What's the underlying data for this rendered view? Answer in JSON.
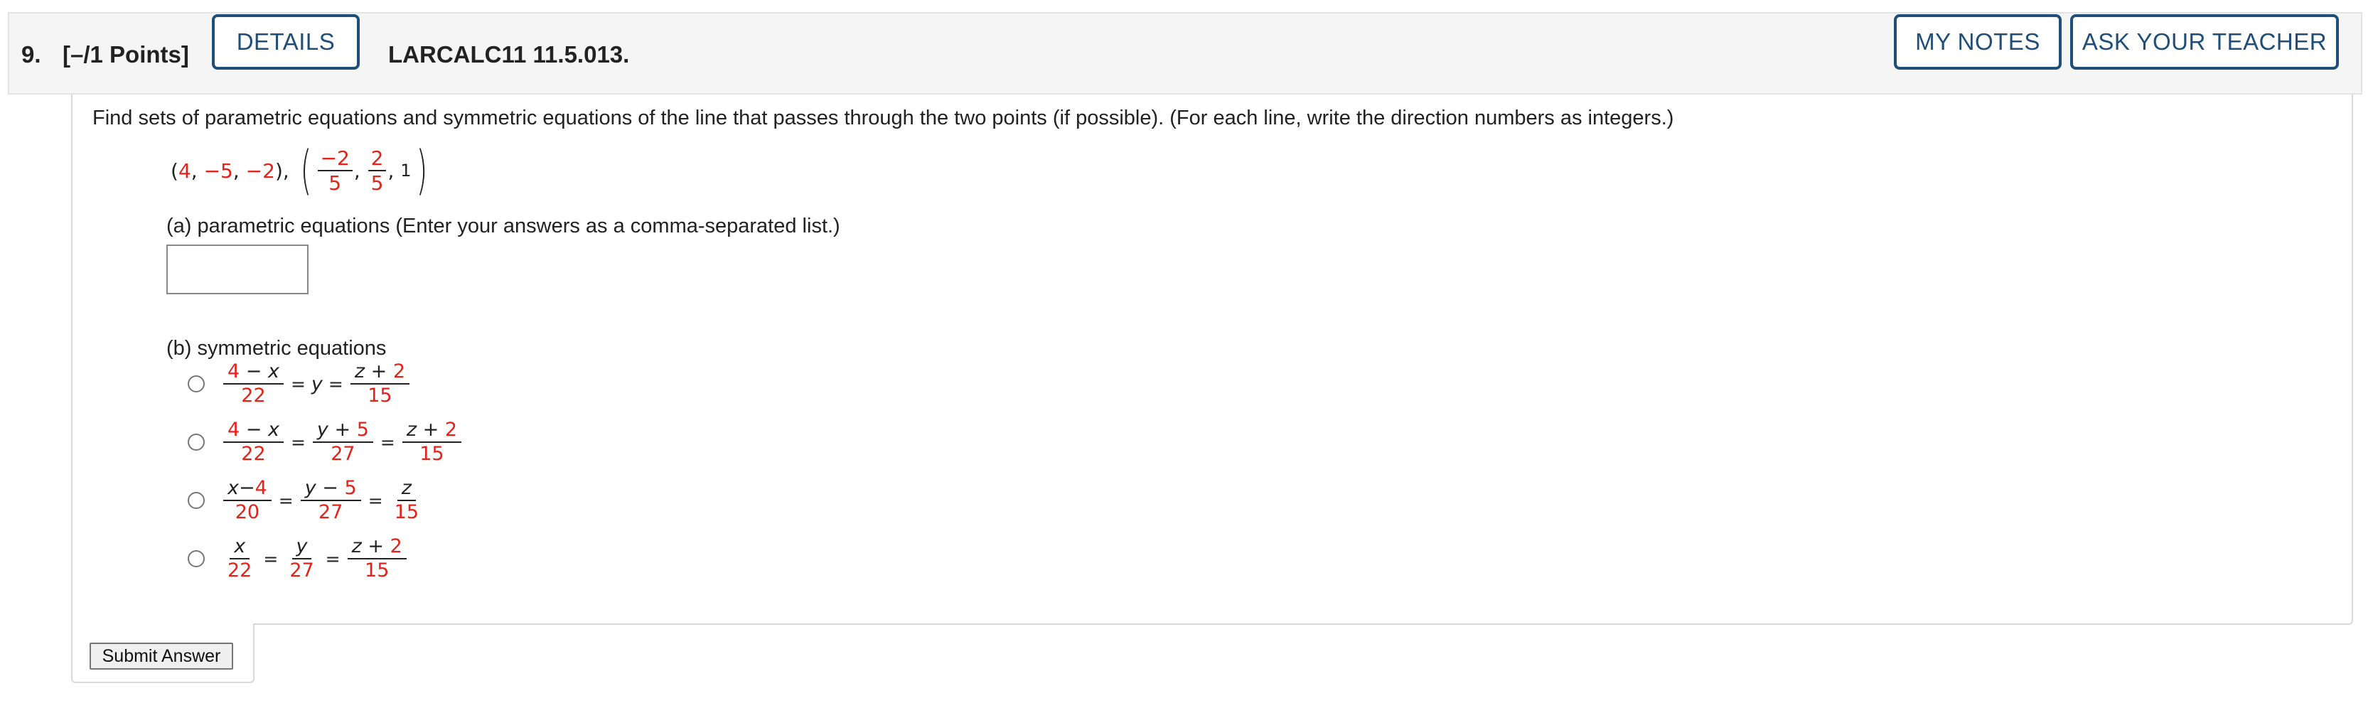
{
  "header": {
    "question_number": "9.",
    "points": "[–/1 Points]",
    "details_label": "DETAILS",
    "reference": "LARCALC11 11.5.013.",
    "my_notes_label": "MY NOTES",
    "ask_teacher_label": "ASK YOUR TEACHER"
  },
  "question": {
    "prompt": "Find sets of parametric equations and symmetric equations of the line that passes through the two points (if possible). (For each line, write the direction numbers as integers.)",
    "point1": {
      "open": "(",
      "x": "4",
      "y": "−5",
      "z": "−2",
      "close": "),"
    },
    "point2": {
      "x_num": "−2",
      "x_den": "5",
      "y_num": "2",
      "y_den": "5",
      "z": "1"
    },
    "separator": ","
  },
  "part_a": {
    "label": "(a) parametric equations (Enter your answers as a comma-separated list.)",
    "value": ""
  },
  "part_b": {
    "label": "(b) symmetric equations",
    "options": [
      {
        "f1_num": "4 − x",
        "f1_den": "22",
        "mid": "y",
        "f3_num": "z + 2",
        "f3_den": "15"
      },
      {
        "f1_num": "4 − x",
        "f1_den": "22",
        "f2_num": "y + 5",
        "f2_den": "27",
        "f3_num": "z + 2",
        "f3_den": "15"
      },
      {
        "f1_num": "x−4",
        "f1_den": "20",
        "f2_num": "y − 5",
        "f2_den": "27",
        "f3_num": "z",
        "f3_den": "15"
      },
      {
        "f1_num": "x",
        "f1_den": "22",
        "f2_num": "y",
        "f2_den": "27",
        "f3_num": "z + 2",
        "f3_den": "15"
      }
    ],
    "equals": "="
  },
  "submit_label": "Submit Answer",
  "colors": {
    "accent": "#1e4e79",
    "answer_red": "#e2231a"
  }
}
